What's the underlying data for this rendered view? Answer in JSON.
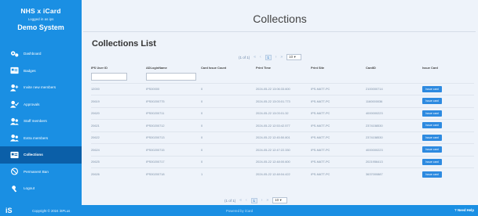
{
  "sidebar": {
    "app_title": "NHS x iCard",
    "logged_in": "Logged in as ips",
    "system": "Demo System",
    "items": [
      {
        "label": "Dashboard",
        "icon": "dashboard-icon",
        "active": false
      },
      {
        "label": "Badges",
        "icon": "badge-icon",
        "active": false
      },
      {
        "label": "Invite new members",
        "icon": "invite-user-icon",
        "active": false
      },
      {
        "label": "Approvals",
        "icon": "approvals-icon",
        "active": false
      },
      {
        "label": "Staff members",
        "icon": "staff-icon",
        "active": false
      },
      {
        "label": "Extra members",
        "icon": "extra-members-icon",
        "active": false
      },
      {
        "label": "Collections",
        "icon": "collections-icon",
        "active": true
      },
      {
        "label": "Permanent Ban",
        "icon": "ban-icon",
        "active": false
      },
      {
        "label": "Logout",
        "icon": "logout-icon",
        "active": false
      }
    ]
  },
  "main": {
    "page_title": "Collections",
    "list_title": "Collections List",
    "pager": {
      "label": "(1 of 1)",
      "first": "«",
      "prev": "‹",
      "current": "1",
      "next": "›",
      "last": "»",
      "page_size": "10"
    },
    "table": {
      "columns": [
        "IPS User ID",
        "ADLoginName",
        "Card Issue Count",
        "Print Time",
        "Print Site",
        "CardID",
        "Issue Card"
      ],
      "rows": [
        {
          "user_id": "12000",
          "ad_login": "IPS00000",
          "count": "0",
          "print_time": "2024-05-22 13:06:33.600",
          "site": "IPS-MATT-PC",
          "card_id": "2100000714",
          "btn": "Issue card"
        },
        {
          "user_id": "20619",
          "ad_login": "IPS00200775",
          "count": "0",
          "print_time": "2024-05-22 13:03:01.773",
          "site": "IPS-MATT-PC",
          "card_id": "1160000036",
          "btn": "Issue card"
        },
        {
          "user_id": "20620",
          "ad_login": "IPS00200711",
          "count": "0",
          "print_time": "2024-05-22 13:03:01.32",
          "site": "IPS-MATT-PC",
          "card_id": "4000000223",
          "btn": "Issue card"
        },
        {
          "user_id": "20621",
          "ad_login": "IPS00200712",
          "count": "0",
          "print_time": "2024-05-22 12:53:42.577",
          "site": "IPS-MATT-PC",
          "card_id": "2374158530",
          "btn": "Issue card"
        },
        {
          "user_id": "20622",
          "ad_login": "IPS00200713",
          "count": "0",
          "print_time": "2024-05-22 12:45:50.801",
          "site": "IPS-MATT-PC",
          "card_id": "2374158530",
          "btn": "Issue card"
        },
        {
          "user_id": "20624",
          "ad_login": "IPS00200715",
          "count": "0",
          "print_time": "2024-05-22 12:47:22.330",
          "site": "IPS-MATT-PC",
          "card_id": "4000000223",
          "btn": "Issue card"
        },
        {
          "user_id": "20625",
          "ad_login": "IPS00200717",
          "count": "0",
          "print_time": "2024-05-22 12:48:00.600",
          "site": "IPS-MATT-PC",
          "card_id": "2021956413",
          "btn": "Issue card"
        },
        {
          "user_id": "20626",
          "ad_login": "IPS00200718",
          "count": "1",
          "print_time": "2024-05-22 12:48:04.422",
          "site": "IPS-MATT-PC",
          "card_id": "3637000887",
          "btn": "Issue card"
        }
      ]
    },
    "pager_bottom": {
      "label": "(1 of 1)",
      "first": "«",
      "prev": "‹",
      "current": "1",
      "next": "›",
      "last": "»",
      "page_size": "10"
    }
  },
  "footer": {
    "logo": "iS",
    "copyright": "Copyright © 2024 iSPLus",
    "middle": "Powered by iCard",
    "help": "? Need Help"
  },
  "colors": {
    "sidebar": "#1a8fe3",
    "active": "#0b5fa8",
    "button": "#2d8ae0",
    "background": "#eef3fa"
  }
}
